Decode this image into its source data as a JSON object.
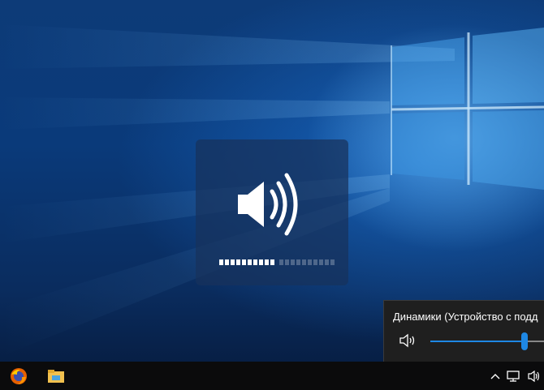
{
  "osd": {
    "icon": "speaker-volume-icon",
    "volume_level": 0.5,
    "segments_total": 20
  },
  "flyout": {
    "device_name": "Динамики (Устройство с подд",
    "icon": "speaker-icon",
    "volume_fraction": 0.82
  },
  "taskbar": {
    "apps": [
      {
        "name": "Firefox",
        "icon": "firefox-icon"
      },
      {
        "name": "File Explorer",
        "icon": "file-explorer-icon"
      }
    ],
    "tray": [
      {
        "icon": "chevron-up-icon"
      },
      {
        "icon": "network-icon"
      },
      {
        "icon": "volume-icon"
      }
    ]
  },
  "colors": {
    "accent": "#1e88e5",
    "taskbar": "#0b0b0c",
    "flyout": "#1f1f1f"
  }
}
